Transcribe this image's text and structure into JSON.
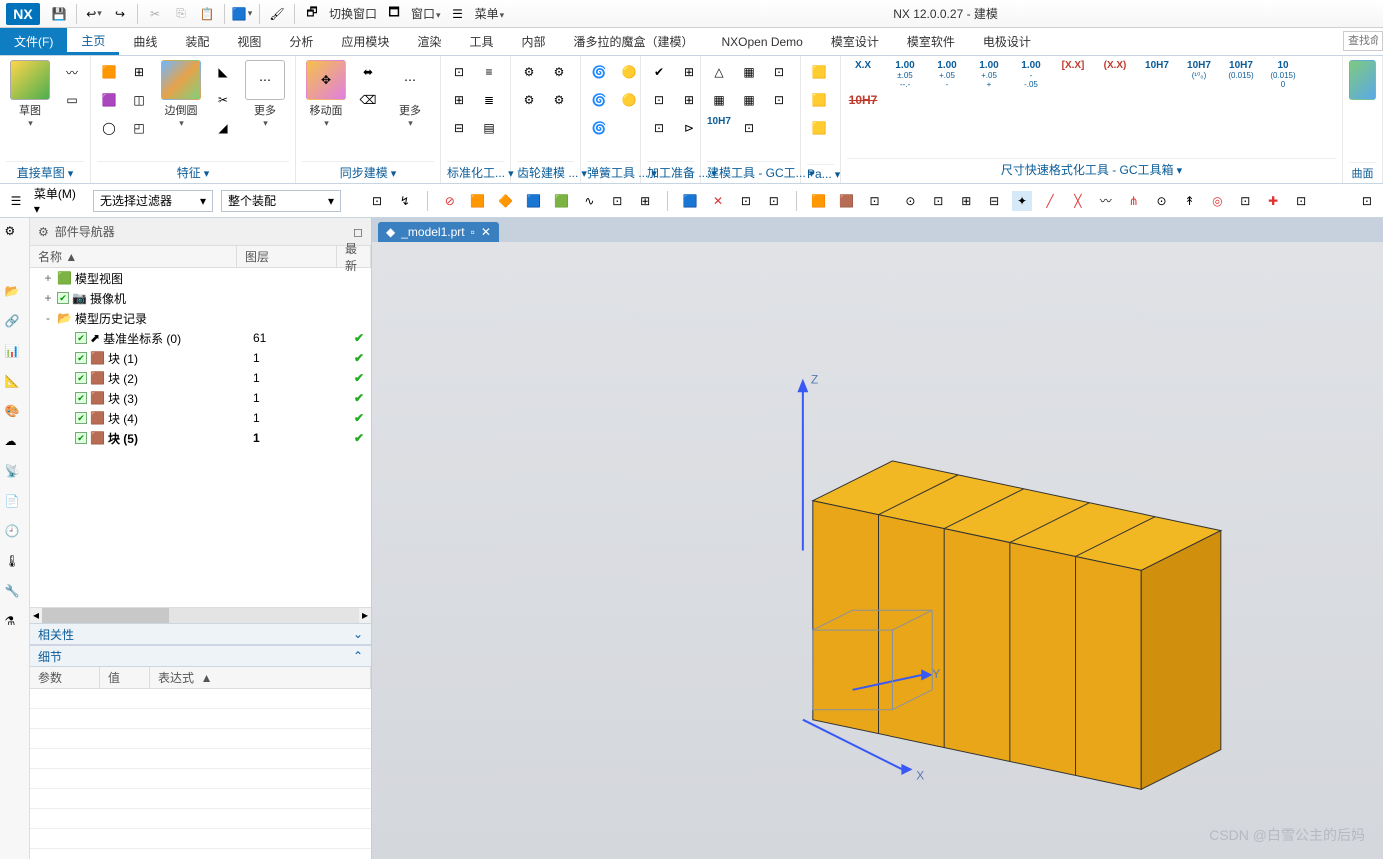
{
  "app": {
    "logo": "NX",
    "title": "NX 12.0.0.27 - 建模"
  },
  "titlebar": {
    "switch_window": "切换窗口",
    "window": "窗口",
    "menu": "菜单"
  },
  "menubar": {
    "file": "文件(F)",
    "tabs": [
      "主页",
      "曲线",
      "装配",
      "视图",
      "分析",
      "应用模块",
      "渲染",
      "工具",
      "内部",
      "潘多拉的魔盒（建模）",
      "NXOpen Demo",
      "模室设计",
      "模室软件",
      "电极设计"
    ],
    "active_index": 0,
    "search_placeholder": "查找命"
  },
  "ribbon": {
    "groups": [
      {
        "label": "直接草图",
        "items": [
          {
            "name": "草图",
            "big": true
          }
        ]
      },
      {
        "label": "特征",
        "items": [
          {
            "name": "边倒圆",
            "big": true
          },
          {
            "name": "更多",
            "big": true
          }
        ]
      },
      {
        "label": "同步建模",
        "items": [
          {
            "name": "移动面",
            "big": true
          },
          {
            "name": "更多",
            "big": true
          }
        ]
      },
      {
        "label": "标准化工...",
        "items": []
      },
      {
        "label": "齿轮建模 ...",
        "items": []
      },
      {
        "label": "弹簧工具 ...",
        "items": []
      },
      {
        "label": "加工准备 ...",
        "items": []
      },
      {
        "label": "建模工具 - GC工...",
        "items": []
      },
      {
        "label": "Pa...",
        "items": []
      },
      {
        "label": "尺寸快速格式化工具 - GC工具箱",
        "items": []
      }
    ],
    "dim_items": [
      {
        "main": "X.X",
        "sub": ""
      },
      {
        "main": "1.00",
        "sub": "±.05",
        "third": "--.-"
      },
      {
        "main": "1.00",
        "sub": "+.05",
        "third": "-"
      },
      {
        "main": "1.00",
        "sub": "+.05",
        "third": "+"
      },
      {
        "main": "1.00",
        "sub": "-",
        "third": "-.05"
      },
      {
        "main": "X.X",
        "sub": "",
        "boxed": true,
        "color": "#c0392b"
      },
      {
        "main": "(X.X)",
        "sub": "",
        "color": "#c0392b"
      },
      {
        "main": "10H7",
        "sub": "",
        "color": "#0a5c99"
      },
      {
        "main": "10H7",
        "sub": "",
        "third": "(¹⁰₀)",
        "color": "#0a5c99"
      },
      {
        "main": "10H7",
        "sub": "(0.015)",
        "color": "#0a5c99"
      },
      {
        "main": "10",
        "sub": "(0.015)",
        "third": "0",
        "color": "#0a5c99"
      },
      {
        "main": "10H7",
        "sub": "",
        "strike": true,
        "color": "#c0392b"
      }
    ]
  },
  "selbar": {
    "menu_label": "菜单(M)",
    "filter": "无选择过滤器",
    "scope": "整个装配"
  },
  "navigator": {
    "title": "部件导航器",
    "columns": {
      "name": "名称",
      "layer": "图层",
      "latest": "最新"
    },
    "tree": [
      {
        "indent": 0,
        "expander": "+",
        "icon": "model-view",
        "label": "模型视图",
        "layer": "",
        "check": false
      },
      {
        "indent": 0,
        "expander": "+",
        "icon": "camera",
        "label": "摄像机",
        "layer": "",
        "check": false,
        "pre_check": true
      },
      {
        "indent": 0,
        "expander": "-",
        "icon": "folder",
        "label": "模型历史记录",
        "layer": "",
        "check": false
      },
      {
        "indent": 1,
        "expander": "",
        "icon": "csys",
        "label": "基准坐标系 (0)",
        "layer": "61",
        "check": true,
        "chk": true
      },
      {
        "indent": 1,
        "expander": "",
        "icon": "block",
        "label": "块 (1)",
        "layer": "1",
        "check": true,
        "chk": true
      },
      {
        "indent": 1,
        "expander": "",
        "icon": "block",
        "label": "块 (2)",
        "layer": "1",
        "check": true,
        "chk": true
      },
      {
        "indent": 1,
        "expander": "",
        "icon": "block",
        "label": "块 (3)",
        "layer": "1",
        "check": true,
        "chk": true
      },
      {
        "indent": 1,
        "expander": "",
        "icon": "block",
        "label": "块 (4)",
        "layer": "1",
        "check": true,
        "chk": true
      },
      {
        "indent": 1,
        "expander": "",
        "icon": "block",
        "label": "块 (5)",
        "layer": "1",
        "check": true,
        "chk": true,
        "bold": true
      }
    ],
    "related": "相关性",
    "details": "细节",
    "detail_cols": {
      "param": "参数",
      "value": "值",
      "expr": "表达式"
    }
  },
  "viewport": {
    "tab": "_model1.prt",
    "axes": {
      "x": "X",
      "y": "Y",
      "z": "Z"
    }
  },
  "watermark": "CSDN @白雪公主的后妈"
}
